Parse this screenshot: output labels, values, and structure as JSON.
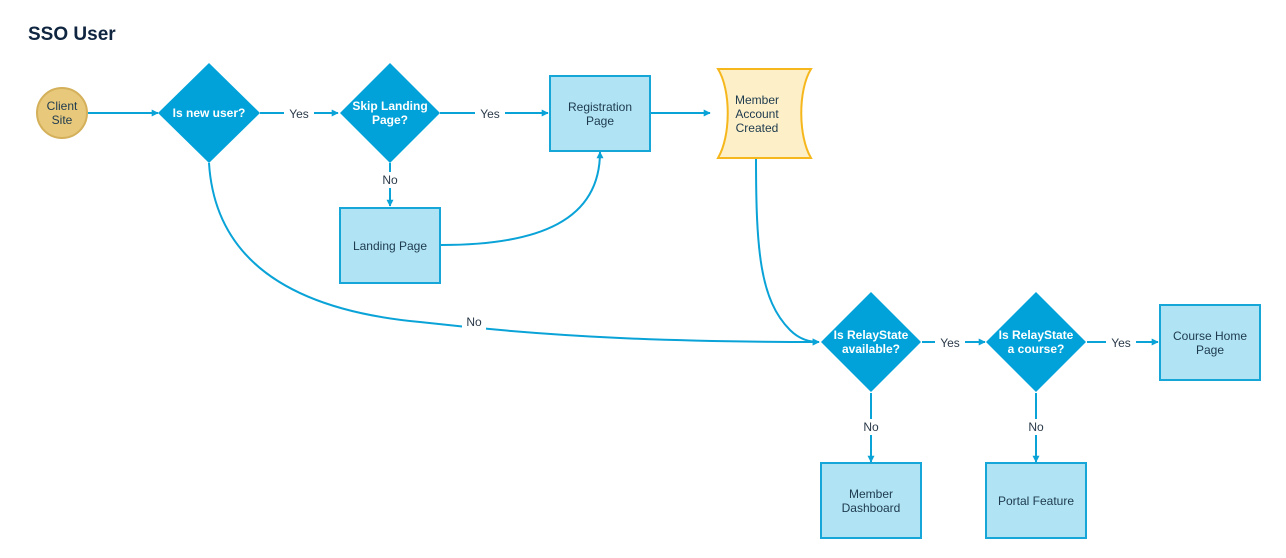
{
  "title": "SSO User",
  "colors": {
    "accent": "#0aa3d8",
    "decision_fill": "#00a2d9",
    "process_fill": "#b0e3f3",
    "process_stroke": "#16a6d8",
    "terminal_fill": "#e8c87a",
    "terminal_stroke": "#d4b05a",
    "document_fill": "#fdefc7",
    "document_stroke": "#f5b71c"
  },
  "nodes": {
    "client_site": {
      "type": "terminal",
      "lines": [
        "Client",
        "Site"
      ]
    },
    "is_new_user": {
      "type": "decision",
      "lines": [
        "Is new user?"
      ]
    },
    "skip_landing": {
      "type": "decision",
      "lines": [
        "Skip Landing",
        "Page?"
      ]
    },
    "registration": {
      "type": "process",
      "lines": [
        "Registration",
        "Page"
      ]
    },
    "member_created": {
      "type": "document",
      "lines": [
        "Member",
        "Account",
        "Created"
      ]
    },
    "landing_page": {
      "type": "process",
      "lines": [
        "Landing Page"
      ]
    },
    "relay_available": {
      "type": "decision",
      "lines": [
        "Is RelayState",
        "available?"
      ]
    },
    "relay_course": {
      "type": "decision",
      "lines": [
        "Is RelayState",
        "a course?"
      ]
    },
    "course_home": {
      "type": "process",
      "lines": [
        "Course Home",
        "Page"
      ]
    },
    "member_dashboard": {
      "type": "process",
      "lines": [
        "Member",
        "Dashboard"
      ]
    },
    "portal_feature": {
      "type": "process",
      "lines": [
        "Portal Feature"
      ]
    }
  },
  "edges": {
    "e1": {
      "from": "client_site",
      "to": "is_new_user",
      "label": ""
    },
    "e2": {
      "from": "is_new_user",
      "to": "skip_landing",
      "label": "Yes"
    },
    "e3": {
      "from": "skip_landing",
      "to": "registration",
      "label": "Yes"
    },
    "e4": {
      "from": "skip_landing",
      "to": "landing_page",
      "label": "No"
    },
    "e5": {
      "from": "landing_page",
      "to": "registration",
      "label": ""
    },
    "e6": {
      "from": "registration",
      "to": "member_created",
      "label": ""
    },
    "e7": {
      "from": "member_created",
      "to": "relay_available",
      "label": ""
    },
    "e8": {
      "from": "is_new_user",
      "to": "relay_available",
      "label": "No"
    },
    "e9": {
      "from": "relay_available",
      "to": "relay_course",
      "label": "Yes"
    },
    "e10": {
      "from": "relay_course",
      "to": "course_home",
      "label": "Yes"
    },
    "e11": {
      "from": "relay_available",
      "to": "member_dashboard",
      "label": "No"
    },
    "e12": {
      "from": "relay_course",
      "to": "portal_feature",
      "label": "No"
    }
  }
}
